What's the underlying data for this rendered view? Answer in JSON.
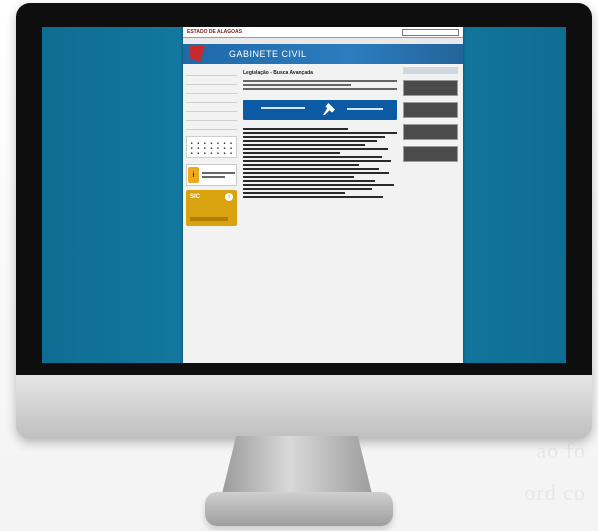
{
  "scene": {
    "background_text_1": "ao fo",
    "background_text_2": "ord co"
  },
  "webpage": {
    "state_name": "ESTADO DE ALAGOAS",
    "banner_title": "GABINETE CIVIL",
    "page_title": "Legislação - Busca Avançada",
    "sic_label": "SIC"
  },
  "colors": {
    "screen_blue": "#167fa8",
    "banner_blue": "#2c7cbf",
    "sic_gold": "#d9a30f"
  }
}
